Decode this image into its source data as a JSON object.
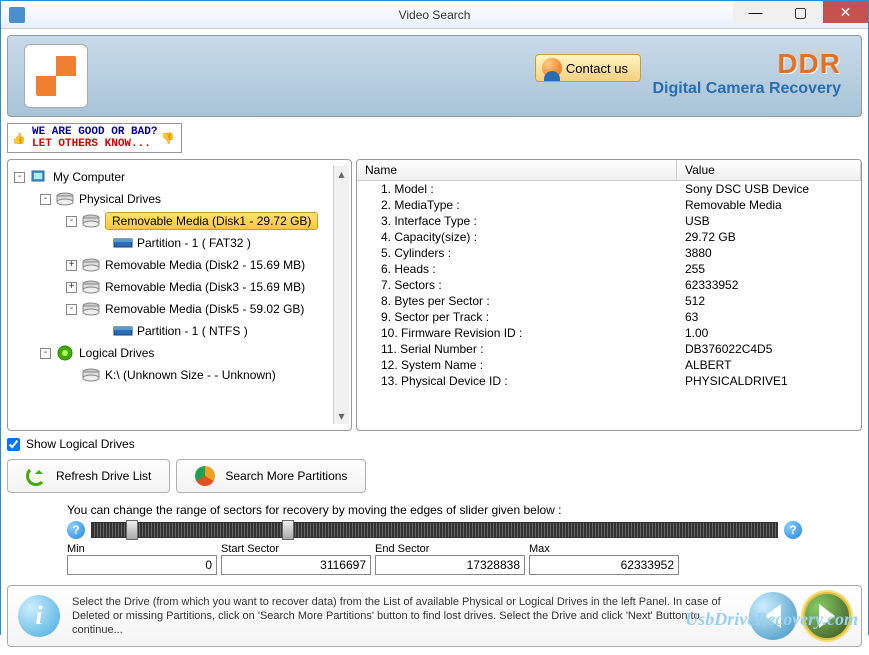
{
  "window": {
    "title": "Video Search"
  },
  "brand": {
    "logo": "DDR",
    "subtitle": "Digital Camera Recovery",
    "contact": "Contact us"
  },
  "feedback": {
    "line1": "WE ARE GOOD OR BAD?",
    "line2": "LET OTHERS KNOW..."
  },
  "tree": {
    "root": "My Computer",
    "phys_label": "Physical Drives",
    "items": [
      {
        "label": "Removable Media (Disk1 - 29.72 GB)",
        "selected": true,
        "toggle": "-",
        "children": [
          "Partition - 1 ( FAT32 )"
        ]
      },
      {
        "label": "Removable Media (Disk2 - 15.69 MB)",
        "toggle": "+"
      },
      {
        "label": "Removable Media (Disk3 - 15.69 MB)",
        "toggle": "+"
      },
      {
        "label": "Removable Media (Disk5 - 59.02 GB)",
        "toggle": "-",
        "children": [
          "Partition - 1 ( NTFS )"
        ]
      }
    ],
    "logical_label": "Logical Drives",
    "logical_items": [
      "K:\\ (Unknown Size  -  - Unknown)"
    ]
  },
  "details": {
    "headers": {
      "name": "Name",
      "value": "Value"
    },
    "rows": [
      {
        "n": "1. Model :",
        "v": "Sony DSC USB Device"
      },
      {
        "n": "2. MediaType :",
        "v": "Removable Media"
      },
      {
        "n": "3. Interface Type :",
        "v": "USB"
      },
      {
        "n": "4. Capacity(size) :",
        "v": "29.72 GB"
      },
      {
        "n": "5. Cylinders :",
        "v": "3880"
      },
      {
        "n": "6. Heads :",
        "v": "255"
      },
      {
        "n": "7. Sectors :",
        "v": "62333952"
      },
      {
        "n": "8. Bytes per Sector :",
        "v": "512"
      },
      {
        "n": "9. Sector per Track :",
        "v": "63"
      },
      {
        "n": "10. Firmware Revision ID :",
        "v": "1.00"
      },
      {
        "n": "11. Serial Number :",
        "v": "DB376022C4D5"
      },
      {
        "n": "12. System Name :",
        "v": "ALBERT"
      },
      {
        "n": "13. Physical Device ID :",
        "v": "PHYSICALDRIVE1"
      }
    ]
  },
  "controls": {
    "show_logical": "Show Logical Drives",
    "refresh": "Refresh Drive List",
    "search": "Search More Partitions"
  },
  "slider": {
    "caption": "You can change the range of sectors for recovery by moving the edges of slider given below :",
    "min_label": "Min",
    "min_value": "0",
    "start_label": "Start Sector",
    "start_value": "3116697",
    "end_label": "End Sector",
    "end_value": "17328838",
    "max_label": "Max",
    "max_value": "62333952"
  },
  "footer": {
    "text": "Select the Drive (from which you want to recover data) from the List of available Physical or Logical Drives in the left Panel. In case of Deleted or missing Partitions, click on 'Search More Partitions' button to find lost drives. Select the Drive and click 'Next' Button to continue..."
  },
  "watermark": "UsbDriveRecovery.com"
}
